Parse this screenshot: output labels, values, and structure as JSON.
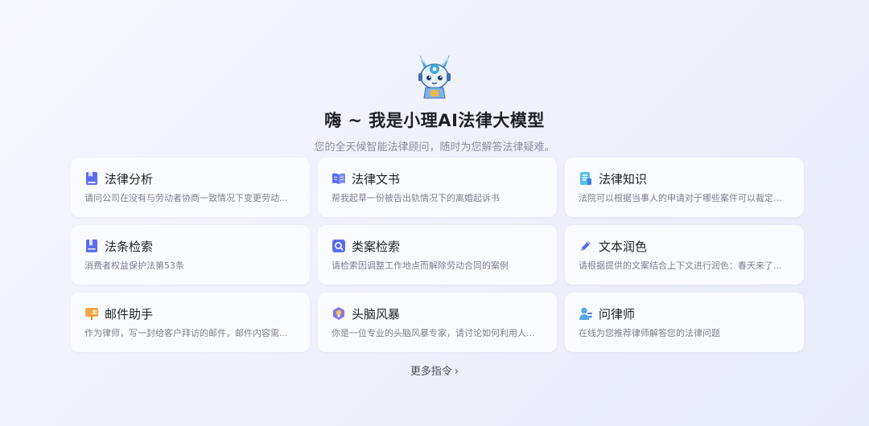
{
  "hero": {
    "title": "嗨 ~ 我是小理AI法律大模型",
    "subtitle": "您的全天候智能法律顾问，随时为您解答法律疑难。"
  },
  "cards": [
    {
      "title": "法律分析",
      "desc": "请问公司在没有与劳动者协商一致情况下变更劳动...",
      "icon": "book-icon"
    },
    {
      "title": "法律文书",
      "desc": "帮我起草一份被告出轨情况下的离婚起诉书",
      "icon": "open-book-icon"
    },
    {
      "title": "法律知识",
      "desc": "法院可以根据当事人的申请对于哪些案件可以裁定...",
      "icon": "document-icon"
    },
    {
      "title": "法条检索",
      "desc": "消费者权益保护法第53条",
      "icon": "bookmark-icon"
    },
    {
      "title": "类案检索",
      "desc": "请检索因调整工作地点而解除劳动合同的案例",
      "icon": "search-doc-icon"
    },
    {
      "title": "文本润色",
      "desc": "请根据提供的文案结合上下文进行润色：春天来了...",
      "icon": "pen-icon"
    },
    {
      "title": "邮件助手",
      "desc": "作为律师，写一封给客户拜访的邮件，邮件内容需...",
      "icon": "mail-flag-icon"
    },
    {
      "title": "头脑风暴",
      "desc": "你是一位专业的头脑风暴专家，请讨论如何利用人...",
      "icon": "brain-icon"
    },
    {
      "title": "问律师",
      "desc": "在线为您推荐律师解答您的法律问题",
      "icon": "lawyer-icon"
    }
  ],
  "more_label": "更多指令",
  "colors": {
    "accent": "#5b6cf0",
    "orange": "#f3a547",
    "cyan": "#58c3e8"
  }
}
